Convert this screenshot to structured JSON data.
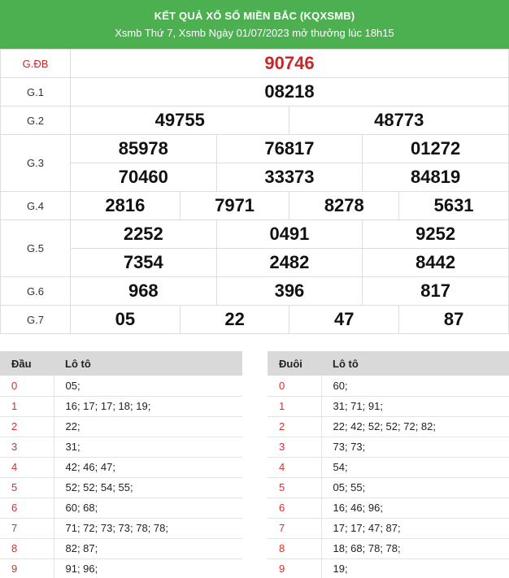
{
  "header": {
    "title": "KẾT QUẢ XỔ SỐ MIỀN BẮC (KQXSMB)",
    "subtitle": "Xsmb Thứ 7, Xsmb Ngày 01/07/2023 mở thưởng lúc 18h15"
  },
  "prizes": {
    "gdb": {
      "label": "G.ĐB",
      "numbers": [
        "90746"
      ]
    },
    "g1": {
      "label": "G.1",
      "numbers": [
        "08218"
      ]
    },
    "g2": {
      "label": "G.2",
      "numbers": [
        "49755",
        "48773"
      ]
    },
    "g3": {
      "label": "G.3",
      "numbers": [
        "85978",
        "76817",
        "01272",
        "70460",
        "33373",
        "84819"
      ]
    },
    "g4": {
      "label": "G.4",
      "numbers": [
        "2816",
        "7971",
        "8278",
        "5631"
      ]
    },
    "g5": {
      "label": "G.5",
      "numbers": [
        "2252",
        "0491",
        "9252",
        "7354",
        "2482",
        "8442"
      ]
    },
    "g6": {
      "label": "G.6",
      "numbers": [
        "968",
        "396",
        "817"
      ]
    },
    "g7": {
      "label": "G.7",
      "numbers": [
        "05",
        "22",
        "47",
        "87"
      ]
    }
  },
  "loto_dau": {
    "headers": [
      "Đầu",
      "Lô tô"
    ],
    "rows": [
      [
        "0",
        "05;"
      ],
      [
        "1",
        "16; 17; 17; 18; 19;"
      ],
      [
        "2",
        "22;"
      ],
      [
        "3",
        "31;"
      ],
      [
        "4",
        "42; 46; 47;"
      ],
      [
        "5",
        "52; 52; 54; 55;"
      ],
      [
        "6",
        "60; 68;"
      ],
      [
        "7",
        "71; 72; 73; 73; 78; 78;"
      ],
      [
        "8",
        "82; 87;"
      ],
      [
        "9",
        "91; 96;"
      ]
    ]
  },
  "loto_duoi": {
    "headers": [
      "Đuôi",
      "Lô tô"
    ],
    "rows": [
      [
        "0",
        "60;"
      ],
      [
        "1",
        "31; 71; 91;"
      ],
      [
        "2",
        "22; 42; 52; 52; 72; 82;"
      ],
      [
        "3",
        "73; 73;"
      ],
      [
        "4",
        "54;"
      ],
      [
        "5",
        "05; 55;"
      ],
      [
        "6",
        "16; 46; 96;"
      ],
      [
        "7",
        "17; 17; 47; 87;"
      ],
      [
        "8",
        "18; 68; 78; 78;"
      ],
      [
        "9",
        "19;"
      ]
    ]
  }
}
